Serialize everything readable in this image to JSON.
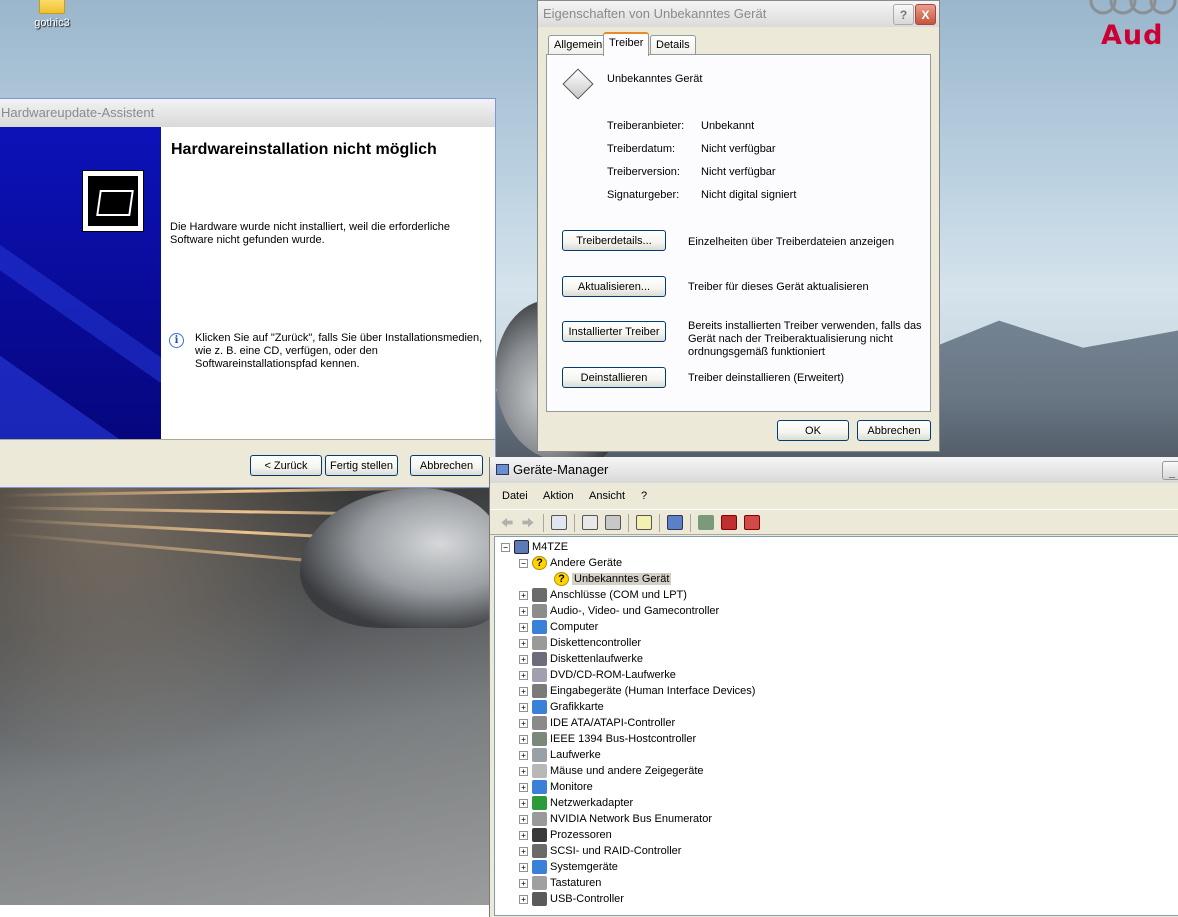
{
  "desktop": {
    "icon_label": "gothic3",
    "brand_text": "Aud",
    "brand_color": "#cc0033"
  },
  "wizard": {
    "title": "Hardwareupdate-Assistent",
    "heading": "Hardwareinstallation nicht möglich",
    "message": "Die Hardware wurde nicht installiert, weil die erforderliche Software nicht gefunden wurde.",
    "hint": "Klicken Sie auf \"Zurück\", falls Sie über Installationsmedien, wie z. B. eine CD, verfügen, oder den Softwareinstallationspfad kennen.",
    "buttons": {
      "back": "< Zurück",
      "finish": "Fertig stellen",
      "cancel": "Abbrechen"
    }
  },
  "properties": {
    "title": "Eigenschaften von Unbekanntes Gerät",
    "tabs": [
      "Allgemein",
      "Treiber",
      "Details"
    ],
    "active_tab": "Treiber",
    "device_name": "Unbekanntes Gerät",
    "fields": [
      {
        "label": "Treiberanbieter:",
        "value": "Unbekannt"
      },
      {
        "label": "Treiberdatum:",
        "value": "Nicht verfügbar"
      },
      {
        "label": "Treiberversion:",
        "value": "Nicht verfügbar"
      },
      {
        "label": "Signaturgeber:",
        "value": "Nicht digital signiert"
      }
    ],
    "actions": [
      {
        "button": "Treiberdetails...",
        "description": "Einzelheiten über Treiberdateien anzeigen"
      },
      {
        "button": "Aktualisieren...",
        "description": "Treiber für dieses Gerät aktualisieren"
      },
      {
        "button": "Installierter Treiber",
        "description": "Bereits installierten Treiber verwenden, falls das Gerät nach der Treiberaktualisierung nicht ordnungsgemäß funktioniert"
      },
      {
        "button": "Deinstallieren",
        "description": "Treiber deinstallieren (Erweitert)"
      }
    ],
    "ok": "OK",
    "cancel": "Abbrechen",
    "help_glyph": "?",
    "close_glyph": "X"
  },
  "device_manager": {
    "title": "Geräte-Manager",
    "minimize_glyph": "_",
    "menu": [
      "Datei",
      "Aktion",
      "Ansicht",
      "?"
    ],
    "root": "M4TZE",
    "unknown_group": "Andere Geräte",
    "unknown_device": "Unbekanntes Gerät",
    "categories": [
      "Anschlüsse (COM und LPT)",
      "Audio-, Video- und Gamecontroller",
      "Computer",
      "Diskettencontroller",
      "Diskettenlaufwerke",
      "DVD/CD-ROM-Laufwerke",
      "Eingabegeräte (Human Interface Devices)",
      "Grafikkarte",
      "IDE ATA/ATAPI-Controller",
      "IEEE 1394 Bus-Hostcontroller",
      "Laufwerke",
      "Mäuse und andere Zeigegeräte",
      "Monitore",
      "Netzwerkadapter",
      "NVIDIA Network Bus Enumerator",
      "Prozessoren",
      "SCSI- und RAID-Controller",
      "Systemgeräte",
      "Tastaturen",
      "USB-Controller"
    ],
    "category_icon_colors": [
      "#6b6b6b",
      "#8c8c8c",
      "#3a7fd8",
      "#9a9a9a",
      "#6c6c7c",
      "#a0a0b0",
      "#7a7a7a",
      "#3a7fd8",
      "#8a8a8a",
      "#7a8a7a",
      "#9aa0a8",
      "#b8b8b8",
      "#3a7fd8",
      "#2a9a3a",
      "#9a9a9a",
      "#3a3a3a",
      "#6a6a6a",
      "#3a7fd8",
      "#a0a0a0",
      "#5a5a5a"
    ]
  }
}
